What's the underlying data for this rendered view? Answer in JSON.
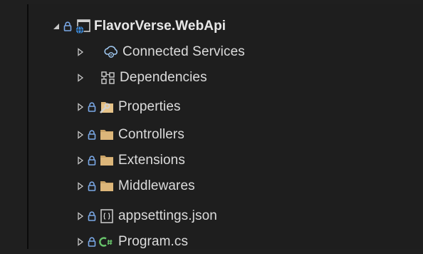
{
  "solution_explorer": {
    "project": {
      "label": "FlavorVerse.WebApi",
      "expanded": true,
      "icon": "web-project-icon"
    },
    "items": [
      {
        "label": "Connected Services",
        "icon": "connected-services-icon",
        "locked": false
      },
      {
        "label": "Dependencies",
        "icon": "dependencies-icon",
        "locked": false
      },
      {
        "label": "Properties",
        "icon": "properties-folder-icon",
        "locked": true
      },
      {
        "label": "Controllers",
        "icon": "folder-icon",
        "locked": true
      },
      {
        "label": "Extensions",
        "icon": "folder-icon",
        "locked": true
      },
      {
        "label": "Middlewares",
        "icon": "folder-icon",
        "locked": true
      },
      {
        "label": "appsettings.json",
        "icon": "json-file-icon",
        "locked": true
      },
      {
        "label": "Program.cs",
        "icon": "csharp-file-icon",
        "locked": true
      }
    ],
    "colors": {
      "background": "#1e1e1e",
      "text": "#dcdcdc",
      "lock": "#7aa8e6",
      "folder": "#dcb67a",
      "csharp": "#68c36b",
      "toggle": "#c8c8c8"
    }
  }
}
